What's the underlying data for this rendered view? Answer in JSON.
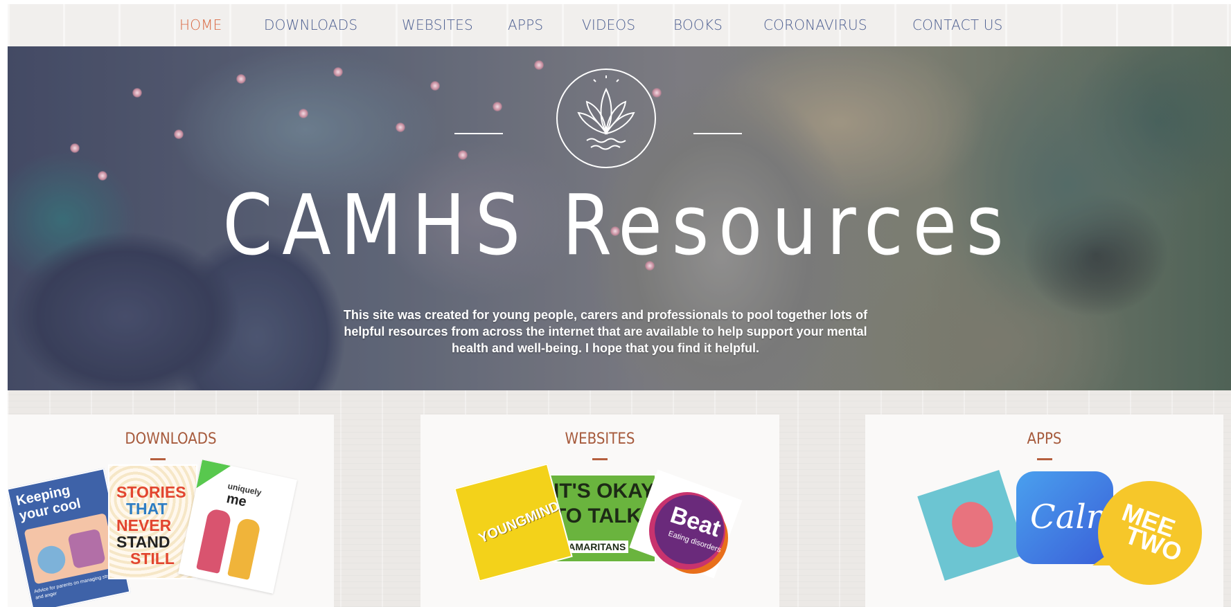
{
  "nav": {
    "items": [
      {
        "label": "HOME",
        "active": true
      },
      {
        "label": "DOWNLOADS",
        "active": false
      },
      {
        "label": "WEBSITES",
        "active": false
      },
      {
        "label": "APPS",
        "active": false
      },
      {
        "label": "VIDEOS",
        "active": false
      },
      {
        "label": "BOOKS",
        "active": false
      },
      {
        "label": "CORONAVIRUS",
        "active": false
      },
      {
        "label": "CONTACT US",
        "active": false
      }
    ],
    "color": "#4b5d8f",
    "active_color": "#d9663f"
  },
  "hero": {
    "logo_icon": "lotus-icon",
    "title": "CAMHS Resources",
    "description": "This site was created for young people, carers and professionals to pool together lots of helpful resources from across the internet that are available to help support your mental health and well-being. I hope that you find it helpful."
  },
  "cards": {
    "downloads": {
      "title": "DOWNLOADS",
      "tiles": {
        "keeping_cool": {
          "line1": "Keeping",
          "line2": "your cool",
          "footer": "Advice for parents on managing stress and anger"
        },
        "stories": {
          "line1": "STORIES",
          "line2": "THAT",
          "line3": "NEVER",
          "line4": "STAND",
          "line5": "STILL"
        },
        "uniquely_me": {
          "line1": "uniquely",
          "line2": "me"
        }
      }
    },
    "websites": {
      "title": "WEBSITES",
      "tiles": {
        "youngminds": {
          "label": "YOUNGMINDS"
        },
        "samaritans": {
          "line1": "IT'S OKAY",
          "line2": "TO TALK",
          "footer": "SAMARITANS"
        },
        "beat": {
          "label": "Beat",
          "sub": "Eating disorders"
        }
      }
    },
    "apps": {
      "title": "APPS",
      "tiles": {
        "calm": {
          "label": "Calm"
        },
        "meetwo": {
          "line1": "MEE",
          "line2": "TWO"
        }
      }
    }
  },
  "colors": {
    "card_title": "#a65a3c",
    "youngminds_yellow": "#f3d21a",
    "samaritans_green": "#6ab43e",
    "beat_purple": "#6a2a7b",
    "calm_blue": "#3a83e8",
    "meetwo_yellow": "#f6c72a",
    "teal_tile": "#6cc5d2"
  }
}
